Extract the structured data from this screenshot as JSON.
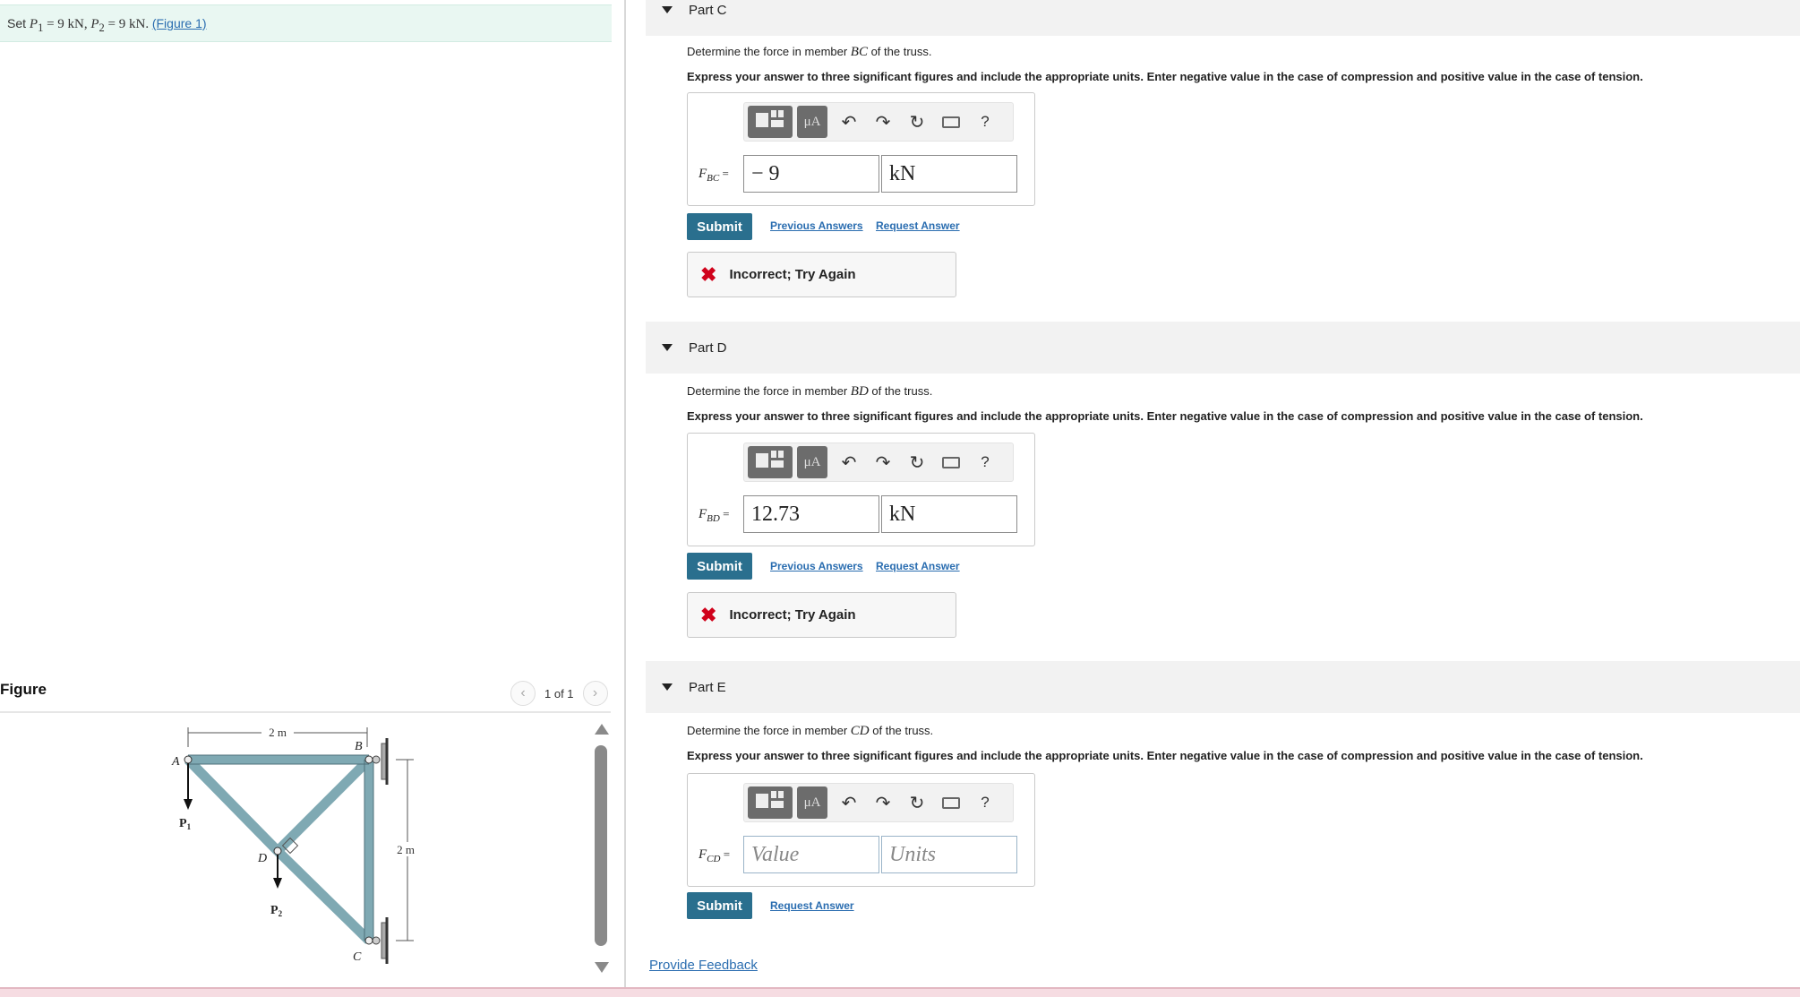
{
  "problem": {
    "text_set": "Set ",
    "p1_sym": "P",
    "p1_sub": "1",
    "p1_val": " = 9 kN",
    "sep": ", ",
    "p2_sym": "P",
    "p2_sub": "2",
    "p2_val": " = 9 kN",
    "after": ". ",
    "figure_link": "(Figure 1)"
  },
  "figure": {
    "title": "Figure",
    "page_indicator": "1 of 1",
    "prev_icon": "chevron-left",
    "next_icon": "chevron-right",
    "labels": {
      "A": "A",
      "B": "B",
      "C": "C",
      "D": "D",
      "P1": "P",
      "P1_sub": "1",
      "P2": "P",
      "P2_sub": "2",
      "dim_top": "2 m",
      "dim_right": "2 m"
    }
  },
  "toolbar": {
    "templates_icon": "templates-icon",
    "units_label": "μA",
    "undo_icon": "↶",
    "redo_icon": "↷",
    "reset_icon": "↻",
    "keyboard_icon": "keyboard-icon",
    "help_label": "?"
  },
  "parts": {
    "c": {
      "header": "Part C",
      "question_pre": "Determine the force in member ",
      "member": "BC",
      "question_post": " of the truss.",
      "instructions": "Express your answer to three significant figures and include the appropriate units. Enter negative value in the case of compression and positive value in the case of tension.",
      "label_main": "F",
      "label_sub": "BC",
      "label_eq": " =",
      "value": "− 9",
      "units": "kN",
      "submit": "Submit",
      "previous_answers": "Previous Answers",
      "request_answer": "Request Answer",
      "feedback": "Incorrect; Try Again"
    },
    "d": {
      "header": "Part D",
      "question_pre": "Determine the force in member ",
      "member": "BD",
      "question_post": " of the truss.",
      "instructions": "Express your answer to three significant figures and include the appropriate units. Enter negative value in the case of compression and positive value in the case of tension.",
      "label_main": "F",
      "label_sub": "BD",
      "label_eq": " =",
      "value": "12.73",
      "units": "kN",
      "submit": "Submit",
      "previous_answers": "Previous Answers",
      "request_answer": "Request Answer",
      "feedback": "Incorrect; Try Again"
    },
    "e": {
      "header": "Part E",
      "question_pre": "Determine the force in member ",
      "member": "CD",
      "question_post": " of the truss.",
      "instructions": "Express your answer to three significant figures and include the appropriate units. Enter negative value in the case of compression and positive value in the case of tension.",
      "label_main": "F",
      "label_sub": "CD",
      "label_eq": " =",
      "value_placeholder": "Value",
      "units_placeholder": "Units",
      "submit": "Submit",
      "request_answer": "Request Answer"
    }
  },
  "footer": {
    "provide_feedback": "Provide Feedback"
  },
  "colors": {
    "banner_bg": "#e9f7f2",
    "submit_bg": "#2a6f8e",
    "link": "#2a6db0",
    "error_x": "#d0021b",
    "truss_member": "#7fa9b3"
  }
}
